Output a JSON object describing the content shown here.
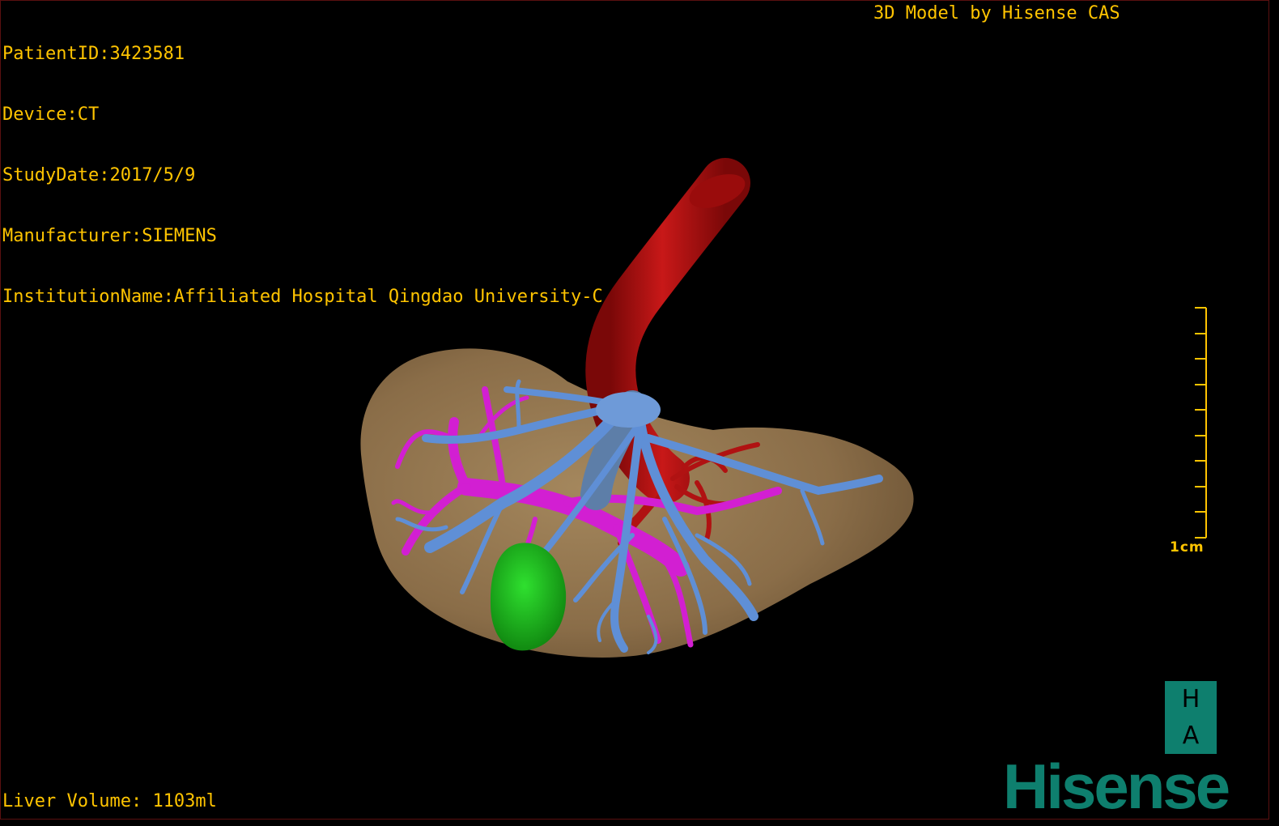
{
  "patient_info": {
    "patient_id_label": "PatientID:",
    "patient_id": "3423581",
    "device_label": "Device:",
    "device": "CT",
    "study_date_label": "StudyDate:",
    "study_date": "2017/5/9",
    "manufacturer_label": "Manufacturer:",
    "manufacturer": "SIEMENS",
    "institution_label": "InstitutionName:",
    "institution": "Affiliated Hospital Qingdao University-C"
  },
  "credit": "3D Model by Hisense CAS",
  "liver_volume": {
    "label": "Liver Volume:",
    "value": "1103ml"
  },
  "scale_bar": {
    "label": "1cm"
  },
  "orientation": {
    "top": "H",
    "bottom": "A"
  },
  "brand": "Hisense",
  "colors": {
    "overlay_text": "#ffc400",
    "liver": "#8b6f4a",
    "artery": "#b01010",
    "portal_vein": "#d21fd2",
    "hepatic_vein": "#5f8fd6",
    "tumor": "#20c820",
    "brand": "#0e7f6e"
  }
}
